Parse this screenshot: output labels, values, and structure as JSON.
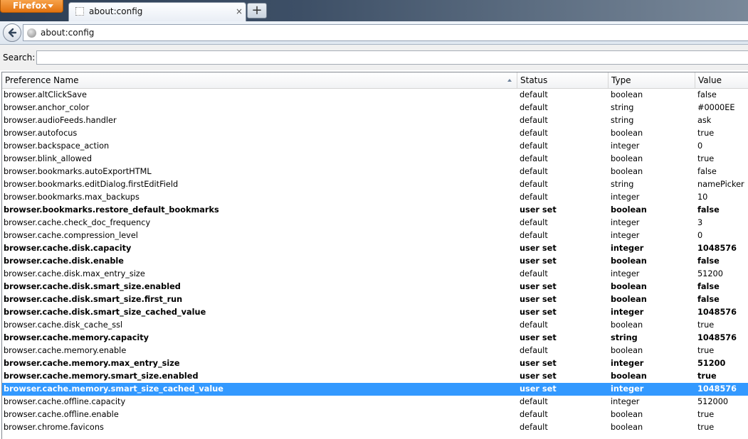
{
  "browser": {
    "menu_button": "Firefox",
    "tab_title": "about:config",
    "tab_close": "×",
    "new_tab": "+",
    "url": "about:config"
  },
  "search": {
    "label": "Search:",
    "value": ""
  },
  "columns": {
    "name": "Preference Name",
    "status": "Status",
    "type": "Type",
    "value": "Value"
  },
  "rows": [
    {
      "name": "browser.altClickSave",
      "status": "default",
      "type": "boolean",
      "value": "false"
    },
    {
      "name": "browser.anchor_color",
      "status": "default",
      "type": "string",
      "value": "#0000EE"
    },
    {
      "name": "browser.audioFeeds.handler",
      "status": "default",
      "type": "string",
      "value": "ask"
    },
    {
      "name": "browser.autofocus",
      "status": "default",
      "type": "boolean",
      "value": "true"
    },
    {
      "name": "browser.backspace_action",
      "status": "default",
      "type": "integer",
      "value": "0"
    },
    {
      "name": "browser.blink_allowed",
      "status": "default",
      "type": "boolean",
      "value": "true"
    },
    {
      "name": "browser.bookmarks.autoExportHTML",
      "status": "default",
      "type": "boolean",
      "value": "false"
    },
    {
      "name": "browser.bookmarks.editDialog.firstEditField",
      "status": "default",
      "type": "string",
      "value": "namePicker"
    },
    {
      "name": "browser.bookmarks.max_backups",
      "status": "default",
      "type": "integer",
      "value": "10"
    },
    {
      "name": "browser.bookmarks.restore_default_bookmarks",
      "status": "user set",
      "type": "boolean",
      "value": "false"
    },
    {
      "name": "browser.cache.check_doc_frequency",
      "status": "default",
      "type": "integer",
      "value": "3"
    },
    {
      "name": "browser.cache.compression_level",
      "status": "default",
      "type": "integer",
      "value": "0"
    },
    {
      "name": "browser.cache.disk.capacity",
      "status": "user set",
      "type": "integer",
      "value": "1048576"
    },
    {
      "name": "browser.cache.disk.enable",
      "status": "user set",
      "type": "boolean",
      "value": "false"
    },
    {
      "name": "browser.cache.disk.max_entry_size",
      "status": "default",
      "type": "integer",
      "value": "51200"
    },
    {
      "name": "browser.cache.disk.smart_size.enabled",
      "status": "user set",
      "type": "boolean",
      "value": "false"
    },
    {
      "name": "browser.cache.disk.smart_size.first_run",
      "status": "user set",
      "type": "boolean",
      "value": "false"
    },
    {
      "name": "browser.cache.disk.smart_size_cached_value",
      "status": "user set",
      "type": "integer",
      "value": "1048576"
    },
    {
      "name": "browser.cache.disk_cache_ssl",
      "status": "default",
      "type": "boolean",
      "value": "true"
    },
    {
      "name": "browser.cache.memory.capacity",
      "status": "user set",
      "type": "string",
      "value": "1048576"
    },
    {
      "name": "browser.cache.memory.enable",
      "status": "default",
      "type": "boolean",
      "value": "true"
    },
    {
      "name": "browser.cache.memory.max_entry_size",
      "status": "user set",
      "type": "integer",
      "value": "51200"
    },
    {
      "name": "browser.cache.memory.smart_size.enabled",
      "status": "user set",
      "type": "boolean",
      "value": "true"
    },
    {
      "name": "browser.cache.memory.smart_size_cached_value",
      "status": "user set",
      "type": "integer",
      "value": "1048576",
      "selected": true
    },
    {
      "name": "browser.cache.offline.capacity",
      "status": "default",
      "type": "integer",
      "value": "512000"
    },
    {
      "name": "browser.cache.offline.enable",
      "status": "default",
      "type": "boolean",
      "value": "true"
    },
    {
      "name": "browser.chrome.favicons",
      "status": "default",
      "type": "boolean",
      "value": "true"
    }
  ],
  "colors": {
    "selection": "#3399ff",
    "firefox_button": "#e2730f"
  },
  "icons": {
    "back": "back-arrow-icon",
    "site": "globe-icon",
    "sort": "sort-ascending-icon"
  }
}
